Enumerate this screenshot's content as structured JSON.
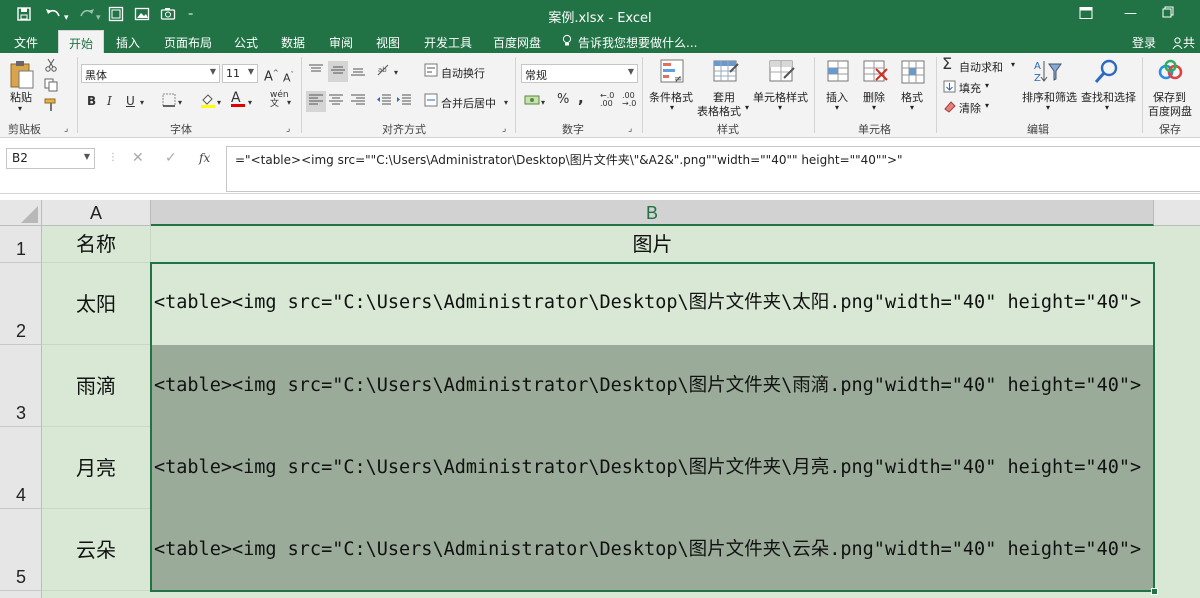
{
  "window": {
    "title": "案例.xlsx - Excel",
    "quick_access": [
      "save-icon",
      "undo-icon",
      "redo-icon",
      "screenshot-icon",
      "picture-icon",
      "camera-icon",
      "customize-icon"
    ]
  },
  "tabs": [
    {
      "label": "文件",
      "active": false
    },
    {
      "label": "开始",
      "active": true
    },
    {
      "label": "插入",
      "active": false
    },
    {
      "label": "页面布局",
      "active": false
    },
    {
      "label": "公式",
      "active": false
    },
    {
      "label": "数据",
      "active": false
    },
    {
      "label": "审阅",
      "active": false
    },
    {
      "label": "视图",
      "active": false
    },
    {
      "label": "开发工具",
      "active": false
    },
    {
      "label": "百度网盘",
      "active": false
    }
  ],
  "tell_me": "告诉我您想要做什么...",
  "login": "登录",
  "share": "共",
  "ribbon": {
    "clipboard": {
      "paste": "粘贴",
      "label": "剪贴板"
    },
    "font": {
      "name": "黑体",
      "size": "11",
      "bold": "B",
      "italic": "I",
      "underline": "U",
      "label": "字体"
    },
    "alignment": {
      "wrap": "自动换行",
      "merge": "合并后居中",
      "label": "对齐方式"
    },
    "number": {
      "format": "常规",
      "percent": "%",
      "comma": ",",
      "label": "数字"
    },
    "styles": {
      "conditional": "条件格式",
      "table1": "套用",
      "table2": "表格格式",
      "cell_styles": "单元格样式",
      "label": "样式"
    },
    "cells": {
      "insert": "插入",
      "delete": "删除",
      "format": "格式",
      "label": "单元格"
    },
    "editing": {
      "autosum": "自动求和",
      "fill": "填充",
      "clear": "清除",
      "sort": "排序和筛选",
      "find": "查找和选择",
      "label": "编辑"
    },
    "save": {
      "line1": "保存到",
      "line2": "百度网盘",
      "label": "保存"
    }
  },
  "formula_bar": {
    "name_box": "B2",
    "fx": "fx",
    "formula": "=\"<table><img src=\"\"C:\\Users\\Administrator\\Desktop\\图片文件夹\\\"&A2&\".png\"\"width=\"\"40\"\" height=\"\"40\"\">\""
  },
  "grid": {
    "columns": [
      "A",
      "B"
    ],
    "rows": [
      {
        "num": "1",
        "a": "名称",
        "b": "图片"
      },
      {
        "num": "2",
        "a": "太阳",
        "b": "<table><img src=\"C:\\Users\\Administrator\\Desktop\\图片文件夹\\太阳.png\"width=\"40\" height=\"40\">"
      },
      {
        "num": "3",
        "a": "雨滴",
        "b": "<table><img src=\"C:\\Users\\Administrator\\Desktop\\图片文件夹\\雨滴.png\"width=\"40\" height=\"40\">"
      },
      {
        "num": "4",
        "a": "月亮",
        "b": "<table><img src=\"C:\\Users\\Administrator\\Desktop\\图片文件夹\\月亮.png\"width=\"40\" height=\"40\">"
      },
      {
        "num": "5",
        "a": "云朵",
        "b": "<table><img src=\"C:\\Users\\Administrator\\Desktop\\图片文件夹\\云朵.png\"width=\"40\" height=\"40\">"
      }
    ]
  },
  "colors": {
    "excel_green": "#217346",
    "cell_green": "#d8e8d5",
    "selection_gray": "#9aab99"
  }
}
